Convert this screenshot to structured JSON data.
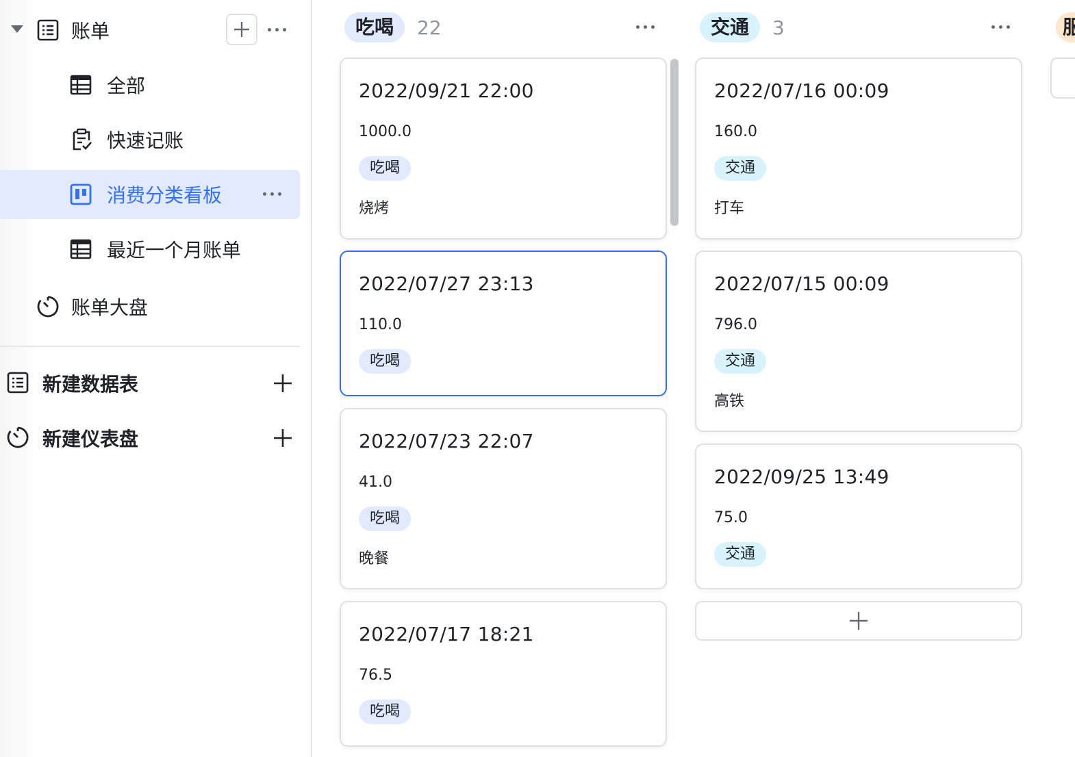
{
  "sidebar": {
    "root": {
      "label": "账单"
    },
    "children": [
      {
        "label": "全部",
        "icon": "grid-table-icon"
      },
      {
        "label": "快速记账",
        "icon": "form-clipboard-icon"
      },
      {
        "label": "消费分类看板",
        "icon": "kanban-icon",
        "active": true
      },
      {
        "label": "最近一个月账单",
        "icon": "grid-table-icon"
      }
    ],
    "dashboard": {
      "label": "账单大盘",
      "icon": "dashboard-icon"
    },
    "actions": [
      {
        "label": "新建数据表",
        "icon": "table-icon"
      },
      {
        "label": "新建仪表盘",
        "icon": "dashboard-icon"
      }
    ]
  },
  "board": {
    "columns": [
      {
        "name": "吃喝",
        "count": "22",
        "tag_color": "#e1eaff",
        "cards": [
          {
            "date": "2022/09/21  22:00",
            "amount": "1000.0",
            "tag": "吃喝",
            "note": "烧烤"
          },
          {
            "date": "2022/07/27  23:13",
            "amount": "110.0",
            "tag": "吃喝",
            "note": ""
          },
          {
            "date": "2022/07/23  22:07",
            "amount": "41.0",
            "tag": "吃喝",
            "note": "晚餐"
          },
          {
            "date": "2022/07/17  18:21",
            "amount": "76.5",
            "tag": "吃喝",
            "note": ""
          }
        ]
      },
      {
        "name": "交通",
        "count": "3",
        "tag_color": "#d9f3fd",
        "cards": [
          {
            "date": "2022/07/16  00:09",
            "amount": "160.0",
            "tag": "交通",
            "note": "打车"
          },
          {
            "date": "2022/07/15  00:09",
            "amount": "796.0",
            "tag": "交通",
            "note": "高铁"
          },
          {
            "date": "2022/09/25  13:49",
            "amount": "75.0",
            "tag": "交通",
            "note": ""
          }
        ]
      },
      {
        "name": "服",
        "tag_color": "#fee7cd"
      }
    ]
  },
  "colors": {
    "accent": "#3370ff",
    "active_bg": "#e1eaff",
    "border": "#dee0e3"
  }
}
